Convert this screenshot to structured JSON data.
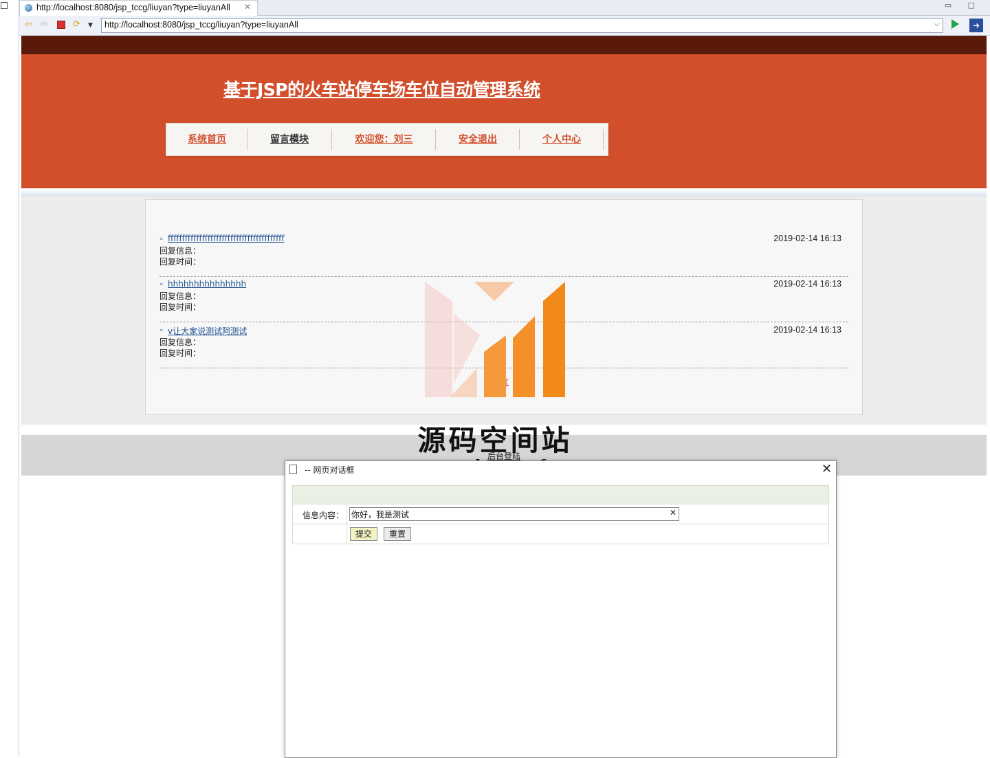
{
  "browser": {
    "tab_title": "http://localhost:8080/jsp_tccg/liuyan?type=liuyanAll",
    "url": "http://localhost:8080/jsp_tccg/liuyan?type=liuyanAll"
  },
  "site": {
    "title": "基于JSP的火车站停车场车位自动管理系统",
    "menu": [
      {
        "label": "系统首页",
        "color": "#d24f2c"
      },
      {
        "label": "留言模块",
        "color": "#333333"
      },
      {
        "label": "欢迎您：刘三",
        "color": "#d24f2c"
      },
      {
        "label": "安全退出",
        "color": "#d24f2c"
      },
      {
        "label": "个人中心",
        "color": "#d24f2c"
      }
    ]
  },
  "messages": [
    {
      "title": "fffffffffffffffffffffffffffffffffffffffff",
      "date": "2019-02-14 16:13",
      "reply_info_label": "回复信息：",
      "reply_time_label": "回复时间："
    },
    {
      "title": "hhhhhhhhhhhhhhh",
      "date": "2019-02-14 16:13",
      "reply_info_label": "回复信息：",
      "reply_time_label": "回复时间："
    },
    {
      "title": "v让大家说测试阿测试",
      "date": "2019-02-14 16:13",
      "reply_info_label": "回复信息：",
      "reply_time_label": "回复时间："
    }
  ],
  "pager_text": "留言",
  "footer": {
    "admin_link": "后台登陆"
  },
  "watermark": {
    "name": "源码空间站",
    "url": "www.shuyue.fun"
  },
  "dialog": {
    "title": "-- 网页对话框",
    "field_label": "信息内容：",
    "field_value": "你好，我是测试",
    "submit_label": "提交",
    "reset_label": "重置"
  },
  "colors": {
    "banner": "#d24f2c",
    "top_bar": "#5a1a0a",
    "link": "#1f4f8f"
  }
}
